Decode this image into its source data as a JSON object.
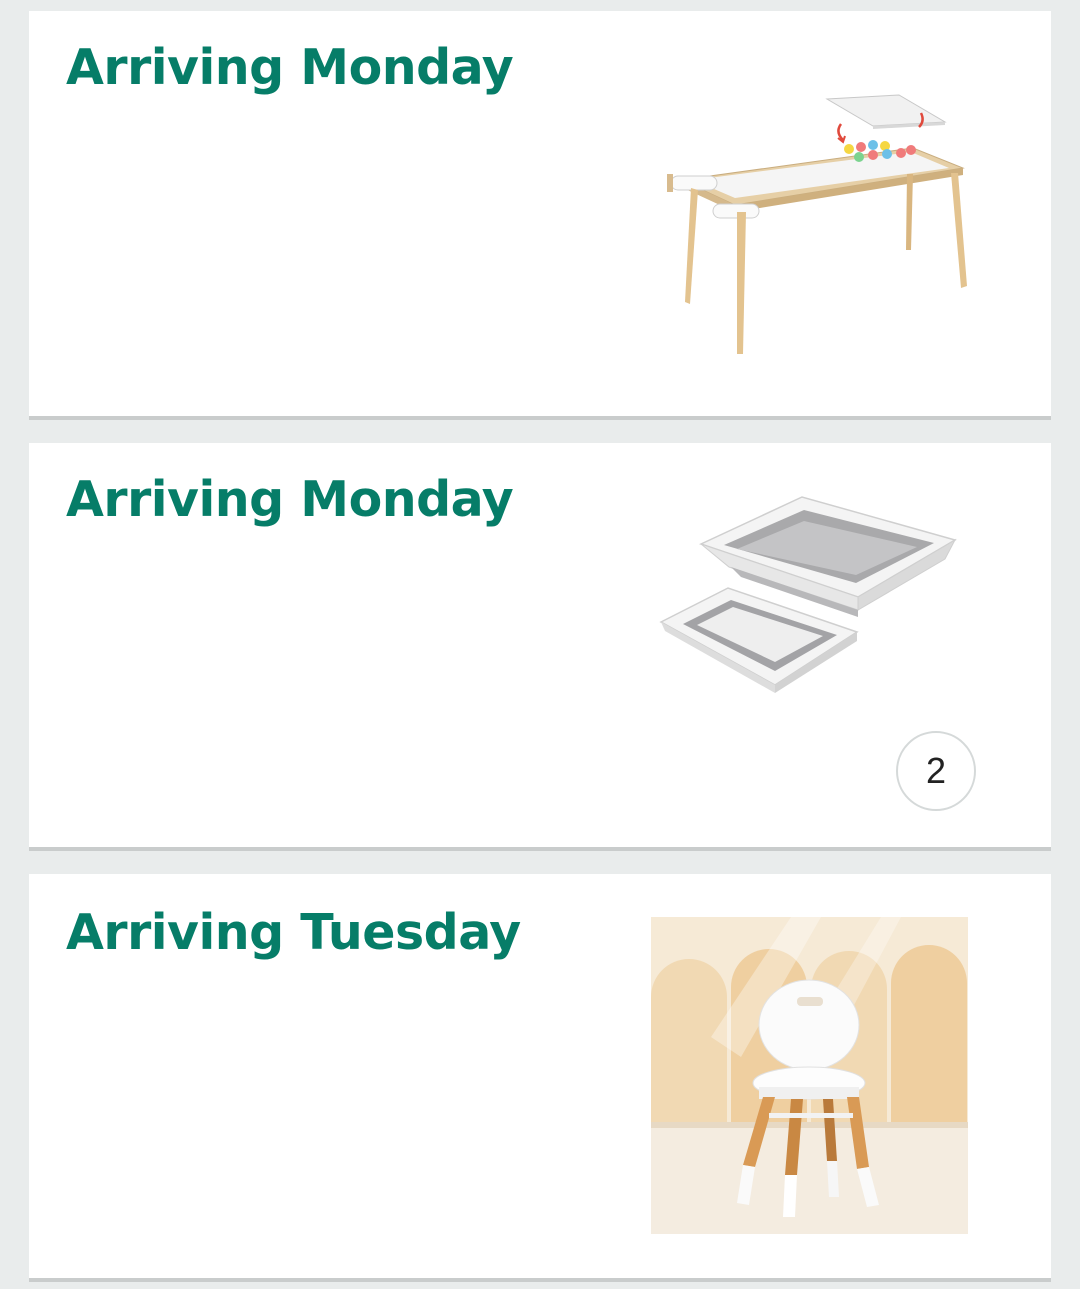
{
  "orders": [
    {
      "arrival": "Arriving Monday",
      "product_image": "kids-activity-table-with-whiteboard-top"
    },
    {
      "arrival": "Arriving Monday",
      "product_image": "collapsible-storage-bins",
      "quantity": "2"
    },
    {
      "arrival": "Arriving Tuesday",
      "product_image": "kids-white-chair-with-wooden-legs"
    }
  ],
  "colors": {
    "arrival_text": "#067d68",
    "page_background": "#e9ecec",
    "card_background": "#ffffff",
    "card_divider": "#c9cccc",
    "badge_border": "#d5d9d9"
  }
}
